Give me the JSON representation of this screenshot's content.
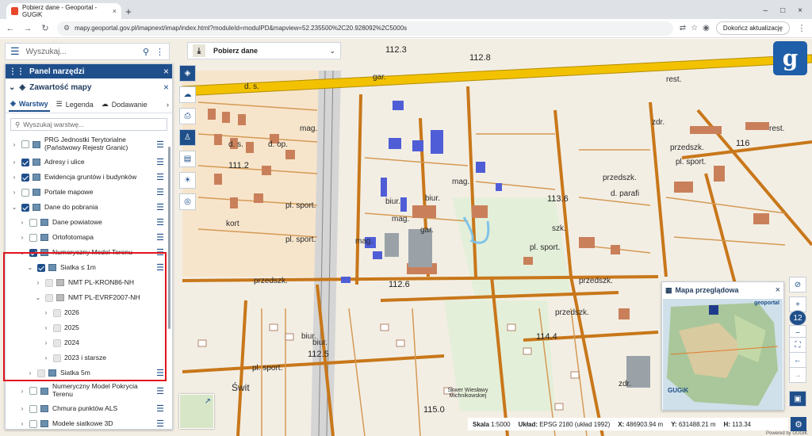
{
  "browser": {
    "tab_title": "Pobierz dane - Geoportal - GUGiK",
    "tab_close": "×",
    "new_tab": "+",
    "url": "mapy.geoportal.gov.pl/imapnext/imap/index.html?moduleId=modulPD&mapview=52.235500%2C20.928092%2C5000s",
    "update_button": "Dokończ aktualizację",
    "controls": [
      "–",
      "□",
      "×"
    ]
  },
  "search": {
    "placeholder": "Wyszukaj..."
  },
  "download_bar": {
    "label": "Pobierz dane"
  },
  "panel": {
    "title": "Panel narzędzi",
    "content_title": "Zawartość mapy",
    "tabs": [
      "Warstwy",
      "Legenda",
      "Dodawanie"
    ],
    "layer_search_placeholder": "Wyszukaj warstwę...",
    "layers": [
      {
        "label": "PRG Jednostki Terytorialne (Państwowy Rejestr Granic)",
        "state": "off",
        "level": 0
      },
      {
        "label": "Adresy i ulice",
        "state": "on",
        "level": 0
      },
      {
        "label": "Ewidencja gruntów i budynków",
        "state": "on",
        "level": 0
      },
      {
        "label": "Portale mapowe",
        "state": "off",
        "level": 0
      },
      {
        "label": "Dane do pobrania",
        "state": "on",
        "level": 0
      },
      {
        "label": "Dane powiatowe",
        "state": "off",
        "level": 1
      },
      {
        "label": "Ortofotomapa",
        "state": "off",
        "level": 1
      },
      {
        "label": "Numeryczny Model Terenu",
        "state": "on",
        "level": 1
      },
      {
        "label": "Siatka ≤ 1m",
        "state": "on",
        "level": 2
      },
      {
        "label": "NMT PL-KRON86-NH",
        "state": "dis",
        "level": 3
      },
      {
        "label": "NMT PL-EVRF2007-NH",
        "state": "dis",
        "level": 3
      },
      {
        "label": "2026",
        "state": "dis",
        "level": 4
      },
      {
        "label": "2025",
        "state": "dis",
        "level": 4
      },
      {
        "label": "2024",
        "state": "dis",
        "level": 4
      },
      {
        "label": "2023 i starsze",
        "state": "dis",
        "level": 4
      },
      {
        "label": "Siatka 5m",
        "state": "dis",
        "level": 2
      },
      {
        "label": "Numeryczny Model Pokrycia Terenu",
        "state": "off",
        "level": 1
      },
      {
        "label": "Chmura punktów ALS",
        "state": "off",
        "level": 1
      },
      {
        "label": "Modele siatkowe 3D",
        "state": "off",
        "level": 1
      }
    ]
  },
  "overview": {
    "title": "Mapa przeglądowa",
    "brand": "GUGiK",
    "geoportal": "geoportal"
  },
  "status": {
    "scale_label": "Skala",
    "scale_value": "1:5000",
    "crs_label": "Układ:",
    "crs_value": "EPSG 2180 (układ 1992)",
    "x_label": "X:",
    "x_value": "486903.94 m",
    "y_label": "Y:",
    "y_value": "631488.21 m",
    "h_label": "H:",
    "h_value": "113.34"
  },
  "right_controls": {
    "zoom_level": "12"
  },
  "powered": "Powered by GUGiK",
  "map_labels": [
    "gar.",
    "biur.",
    "mag.",
    "d. s.",
    "zdr.",
    "rest.",
    "przedszk.",
    "pl. sport.",
    "d. op.",
    "kort",
    "szk.",
    "d. parafi",
    "Świt",
    "112.8",
    "112.6",
    "112.5",
    "113.6",
    "114.4",
    "115.0",
    "116",
    "111.2",
    "112.3",
    "Skwer Wiesławy Michnikowskiej"
  ],
  "colors": {
    "primary": "#1f4f8b",
    "highlight": "#e0141e",
    "road": "#f2c200"
  }
}
